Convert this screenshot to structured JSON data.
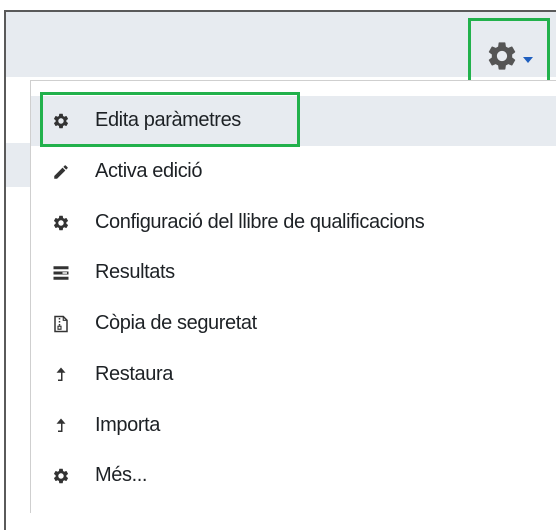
{
  "toolbar": {
    "settings_toggle_icon": "gear-icon",
    "caret_icon": "caret-down-icon",
    "accent_color": "#1f5fbf",
    "highlight_color": "#22b14c"
  },
  "menu": {
    "items": [
      {
        "label": "Edita paràmetres",
        "icon": "gear-icon"
      },
      {
        "label": "Activa edició",
        "icon": "pencil-icon"
      },
      {
        "label": "Configuració del llibre de qualificacions",
        "icon": "gear-icon"
      },
      {
        "label": "Resultats",
        "icon": "list-icon"
      },
      {
        "label": "Còpia de seguretat",
        "icon": "archive-file-icon"
      },
      {
        "label": "Restaura",
        "icon": "upload-icon"
      },
      {
        "label": "Importa",
        "icon": "upload-icon"
      },
      {
        "label": "Més...",
        "icon": "gear-icon"
      }
    ]
  }
}
